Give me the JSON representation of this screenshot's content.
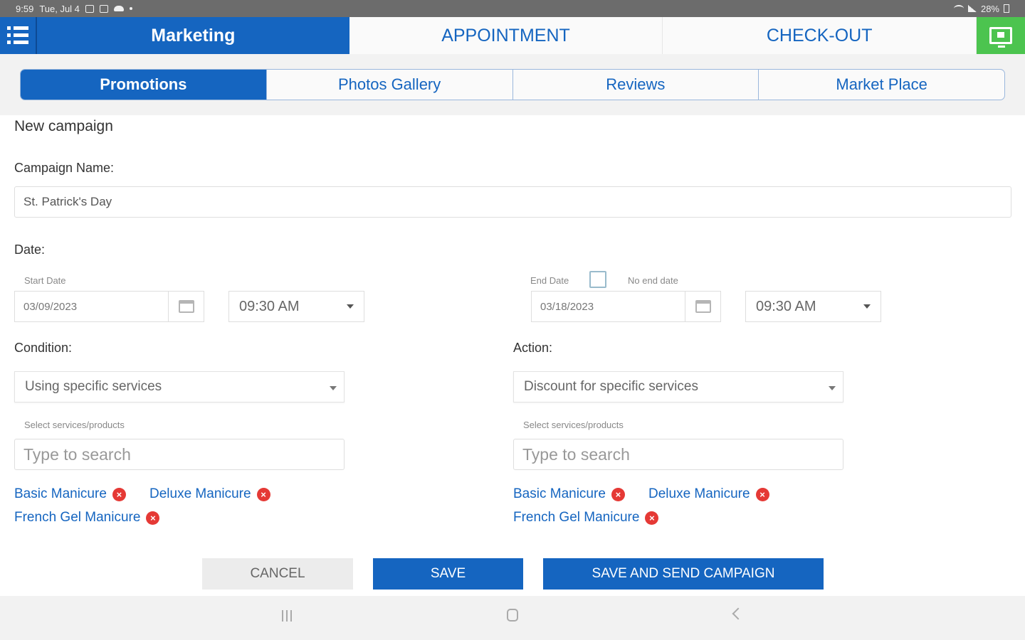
{
  "status_bar": {
    "time": "9:59",
    "date": "Tue, Jul 4",
    "battery": "28%"
  },
  "nav": {
    "marketing_label": "Marketing",
    "appointment_label": "APPOINTMENT",
    "checkout_label": "CHECK-OUT"
  },
  "subtabs": [
    {
      "label": "Promotions",
      "active": true
    },
    {
      "label": "Photos Gallery",
      "active": false
    },
    {
      "label": "Reviews",
      "active": false
    },
    {
      "label": "Market Place",
      "active": false
    }
  ],
  "form": {
    "title": "New campaign",
    "campaign_name_label": "Campaign Name:",
    "campaign_name_value": "St. Patrick's Day",
    "date_label": "Date:",
    "start_date_label": "Start Date",
    "start_date_value": "03/09/2023",
    "start_time_value": "09:30 AM",
    "end_date_label": "End Date",
    "no_end_date_label": "No end date",
    "end_date_value": "03/18/2023",
    "end_time_value": "09:30 AM",
    "condition_label": "Condition:",
    "condition_value": "Using specific services",
    "action_label": "Action:",
    "action_value": "Discount for specific services",
    "select_services_label": "Select services/products",
    "search_placeholder": "Type to search",
    "condition_tags": [
      "Basic Manicure",
      "Deluxe Manicure",
      "French Gel Manicure"
    ],
    "action_tags": [
      "Basic Manicure",
      "Deluxe Manicure",
      "French Gel Manicure"
    ]
  },
  "buttons": {
    "cancel": "CANCEL",
    "save": "SAVE",
    "save_send": "SAVE AND SEND CAMPAIGN"
  },
  "colors": {
    "primary": "#1565c0",
    "accent_green": "#4cc44f",
    "remove_red": "#e53935"
  },
  "icons": [
    "menu-icon",
    "monitor-icon",
    "calendar-icon",
    "chevron-down-icon",
    "remove-icon",
    "recent-apps-icon",
    "home-icon",
    "back-icon"
  ]
}
